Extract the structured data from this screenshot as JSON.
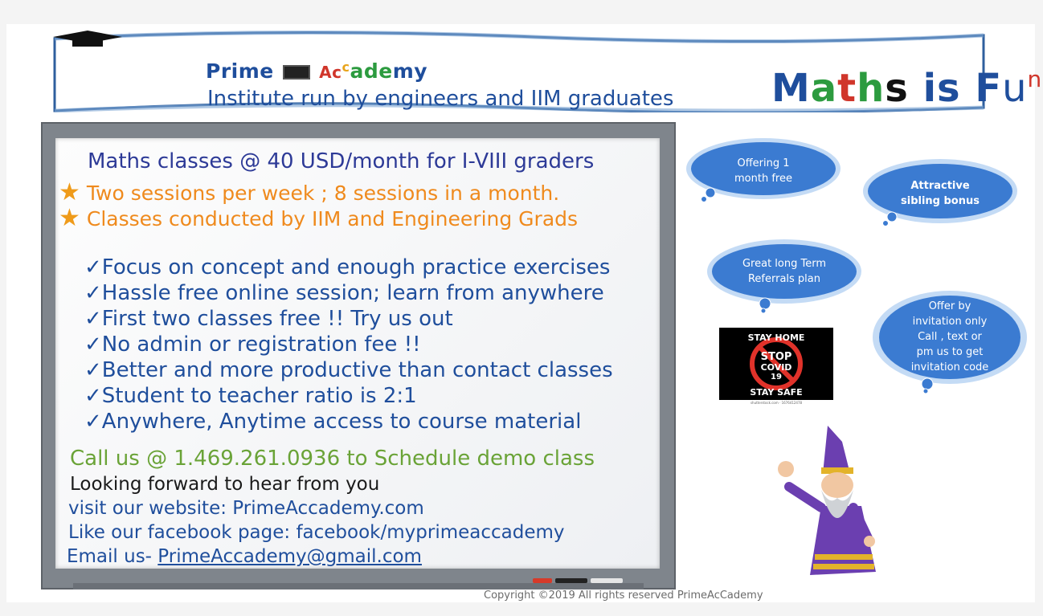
{
  "banner": {
    "brand_parts": [
      "Prime",
      "Ac",
      "c",
      "ade",
      "my"
    ],
    "tagline": "Institute run by engineers and IIM graduates",
    "fun_title_parts": [
      "M",
      "a",
      "t",
      "h",
      "s",
      " is ",
      "F",
      "u",
      "n"
    ]
  },
  "board": {
    "heading": "Maths classes @ 40 USD/month for I-VIII graders",
    "highlights": [
      "Two sessions per week ; 8 sessions in a month.",
      "Classes conducted by IIM and Engineering Grads"
    ],
    "features": [
      "Focus on concept and enough practice exercises",
      "Hassle free online session; learn from anywhere",
      "First two classes free !! Try us out",
      "No admin or registration fee !!",
      "Better and more productive than contact classes",
      "Student to teacher ratio is 2:1",
      "Anywhere, Anytime access to course material"
    ],
    "call": "Call us @ 1.469.261.0936 to Schedule demo class",
    "forward": "Looking forward to hear from you",
    "website": "visit our website: PrimeAccademy.com",
    "facebook": "Like our facebook page: facebook/myprimeaccademy",
    "email_label": "Email us- ",
    "email": "PrimeAccademy@gmail.com"
  },
  "clouds": {
    "c1": [
      "Offering 1",
      "month free"
    ],
    "c2": [
      "Attractive",
      "sibling bonus"
    ],
    "c3": [
      "Great long Term",
      "Referrals plan"
    ],
    "c4": [
      "Offer by",
      "invitation only",
      "Call , text  or",
      "pm us to get",
      "invitation code"
    ]
  },
  "covid": {
    "top": "STAY HOME",
    "stop": "STOP",
    "covid": "COVID",
    "num": "19",
    "bottom": "STAY SAFE",
    "credit": "shutterstock.com · 1676412478"
  },
  "footer": {
    "copyright": "Copyright ©2019 All rights reserved PrimeAcCademy"
  },
  "colors": {
    "cloud_fill": "#3b7bd1",
    "cloud_glow": "#9cc3ef",
    "brand_blue": "#1f4e9c",
    "orange": "#ef8a1d",
    "green": "#6aa337"
  }
}
